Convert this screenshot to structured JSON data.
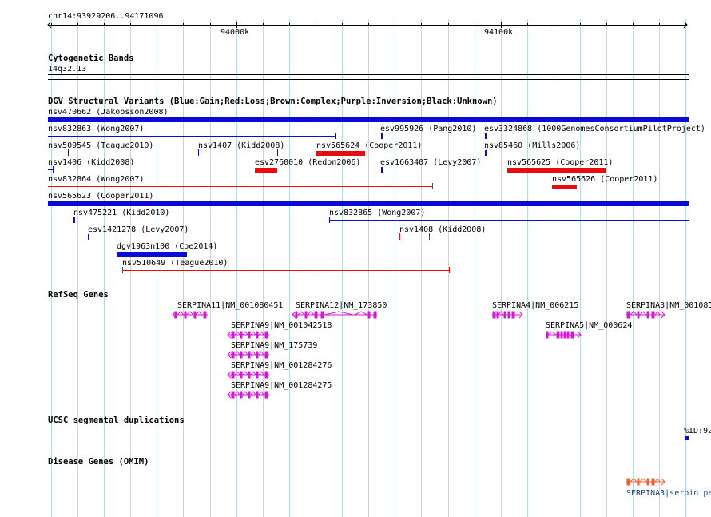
{
  "ruler": {
    "locus": "chr14:93929206..94171096",
    "tick_94000": "94000k",
    "tick_94100": "94100k"
  },
  "tracks": {
    "cytobands": {
      "title": "Cytogenetic Bands",
      "band": "14q32.13"
    },
    "dgv": {
      "title": "DGV Structural Variants (Blue:Gain;Red:Loss;Brown:Complex;Purple:Inversion;Black:Unknown)",
      "features": [
        {
          "label": "nsv470662 (Jakobsson2008)",
          "color": "#0a0ad6"
        },
        {
          "label": "nsv832863 (Wong2007)",
          "color": "#0a0ad6"
        },
        {
          "label": "esv995926 (Pang2010)",
          "color": "#0a0ad6"
        },
        {
          "label": "esv3324868 (1000GenomesConsortiumPilotProject)",
          "color": "#0a0ad6"
        },
        {
          "label": "nsv509545 (Teague2010)",
          "color": "#0a0ad6"
        },
        {
          "label": "nsv1407 (Kidd2008)",
          "color": "#0a0ad6"
        },
        {
          "label": "nsv565624 (Cooper2011)",
          "color": "#e80d0d"
        },
        {
          "label": "nsv85460 (Mills2006)",
          "color": "#0a0ad6"
        },
        {
          "label": "nsv1406 (Kidd2008)",
          "color": "#0a0ad6"
        },
        {
          "label": "esv2760010 (Redon2006)",
          "color": "#e80d0d"
        },
        {
          "label": "esv1663407 (Levy2007)",
          "color": "#0a0ad6"
        },
        {
          "label": "nsv565625 (Cooper2011)",
          "color": "#e80d0d"
        },
        {
          "label": "nsv832864 (Wong2007)",
          "color": "#e80d0d"
        },
        {
          "label": "nsv565626 (Cooper2011)",
          "color": "#e80d0d"
        },
        {
          "label": "nsv565623 (Cooper2011)",
          "color": "#0a0ad6"
        },
        {
          "label": "nsv475221 (Kidd2010)",
          "color": "#0a0ad6"
        },
        {
          "label": "nsv832865 (Wong2007)",
          "color": "#0a0ad6"
        },
        {
          "label": "esv1421278 (Levy2007)",
          "color": "#0a0ad6"
        },
        {
          "label": "nsv1408 (Kidd2008)",
          "color": "#e80d0d"
        },
        {
          "label": "dgv1963n100 (Coe2014)",
          "color": "#0a0ad6"
        },
        {
          "label": "nsv510649 (Teague2010)",
          "color": "#e80d0d"
        }
      ]
    },
    "refseq": {
      "title": "RefSeq Genes",
      "color": "#d21ad2",
      "genes": [
        {
          "label": "SERPINA11|NM_001080451"
        },
        {
          "label": "SERPINA12|NM_173850"
        },
        {
          "label": "SERPINA4|NM_006215"
        },
        {
          "label": "SERPINA3|NM_001085"
        },
        {
          "label": "SERPINA9|NM_001042518"
        },
        {
          "label": "SERPINA5|NM_000624"
        },
        {
          "label": "SERPINA9|NM_175739"
        },
        {
          "label": "SERPINA9|NM_001284276"
        },
        {
          "label": "SERPINA9|NM_001284275"
        }
      ]
    },
    "segdups": {
      "title": "UCSC segmental duplications",
      "feature_label": "%ID:92"
    },
    "omim": {
      "title": "Disease Genes (OMIM)",
      "color": "#f06030",
      "feature_label": "SERPINA3|serpin pe"
    }
  }
}
